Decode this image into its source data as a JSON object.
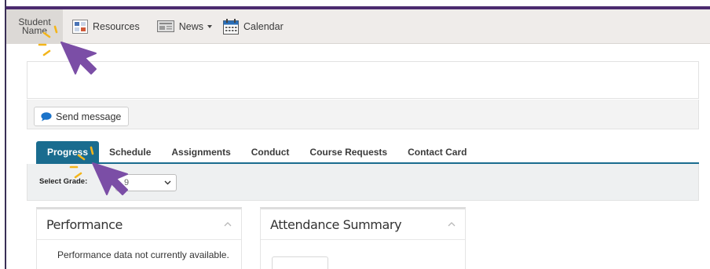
{
  "navbar": {
    "student_line1": "Student",
    "student_line2": "Name",
    "resources": "Resources",
    "news": "News",
    "calendar": "Calendar"
  },
  "actions": {
    "send_message": "Send message"
  },
  "tabs": [
    {
      "label": "Progress",
      "active": true
    },
    {
      "label": "Schedule"
    },
    {
      "label": "Assignments"
    },
    {
      "label": "Conduct"
    },
    {
      "label": "Course Requests"
    },
    {
      "label": "Contact Card"
    }
  ],
  "grade_filter": {
    "label": "Select Grade:",
    "selected": "9"
  },
  "panels": {
    "performance": {
      "title": "Performance",
      "message": "Performance data not currently available."
    },
    "attendance": {
      "title": "Attendance Summary"
    }
  },
  "colors": {
    "accent": "#1a6c8f",
    "brand": "#4b2b6f",
    "cursor": "#7b4ea6",
    "cursor_sparkle": "#f3b51b"
  }
}
